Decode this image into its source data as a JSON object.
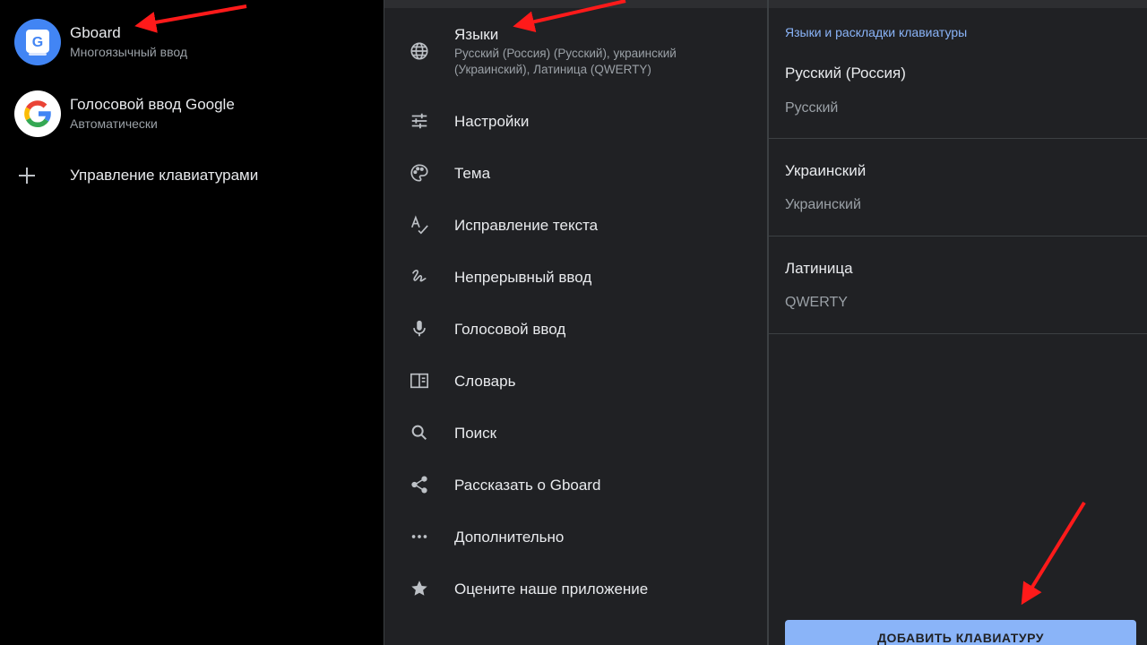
{
  "left": {
    "items": [
      {
        "title": "Gboard",
        "subtitle": "Многоязычный ввод",
        "icon": "gboard-icon"
      },
      {
        "title": "Голосовой ввод Google",
        "subtitle": "Автоматически",
        "icon": "google-g-icon"
      }
    ],
    "manage_label": "Управление клавиатурами"
  },
  "middle": {
    "languages": {
      "label": "Языки",
      "subtitle": "Русский (Россия) (Русский), украинский (Украинский), Латиница (QWERTY)"
    },
    "items": [
      {
        "label": "Настройки",
        "icon": "sliders-icon"
      },
      {
        "label": "Тема",
        "icon": "palette-icon"
      },
      {
        "label": "Исправление текста",
        "icon": "spellcheck-icon"
      },
      {
        "label": "Непрерывный ввод",
        "icon": "gesture-icon"
      },
      {
        "label": "Голосовой ввод",
        "icon": "mic-icon"
      },
      {
        "label": "Словарь",
        "icon": "dictionary-icon"
      },
      {
        "label": "Поиск",
        "icon": "search-icon"
      },
      {
        "label": "Рассказать о Gboard",
        "icon": "share-icon"
      },
      {
        "label": "Дополнительно",
        "icon": "more-horiz-icon"
      },
      {
        "label": "Оцените наше приложение",
        "icon": "star-icon"
      }
    ]
  },
  "right": {
    "section_title": "Языки и раскладки клавиатуры",
    "languages": [
      {
        "name": "Русский (Россия)",
        "layout": "Русский"
      },
      {
        "name": "Украинский",
        "layout": "Украинский"
      },
      {
        "name": "Латиница",
        "layout": "QWERTY"
      }
    ],
    "add_button": "ДОБАВИТЬ КЛАВИАТУРУ"
  },
  "colors": {
    "accent": "#8ab4f8",
    "annotation_arrow": "#ff1a1a",
    "panel_bg": "#202124"
  }
}
